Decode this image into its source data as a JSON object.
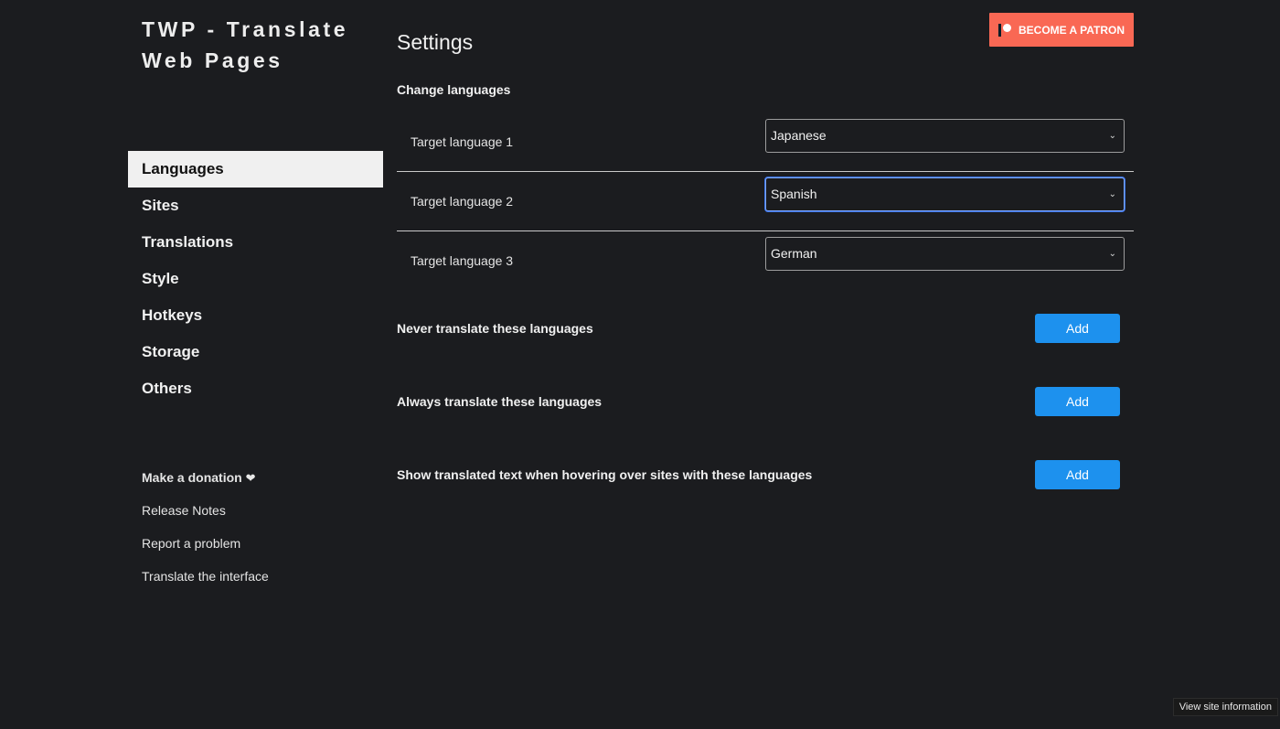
{
  "app": {
    "title": "TWP - Translate Web Pages"
  },
  "header": {
    "page_title": "Settings",
    "patron_label": "BECOME A PATRON"
  },
  "sidebar": {
    "items": [
      {
        "label": "Languages",
        "active": true
      },
      {
        "label": "Sites",
        "active": false
      },
      {
        "label": "Translations",
        "active": false
      },
      {
        "label": "Style",
        "active": false
      },
      {
        "label": "Hotkeys",
        "active": false
      },
      {
        "label": "Storage",
        "active": false
      },
      {
        "label": "Others",
        "active": false
      }
    ],
    "links": {
      "donation": "Make a donation",
      "donation_heart": "❤",
      "release_notes": "Release Notes",
      "report_problem": "Report a problem",
      "translate_interface": "Translate the interface"
    }
  },
  "languages": {
    "heading": "Change languages",
    "targets": [
      {
        "label": "Target language 1",
        "value": "Japanese"
      },
      {
        "label": "Target language 2",
        "value": "Spanish"
      },
      {
        "label": "Target language 3",
        "value": "German"
      }
    ],
    "options": [
      {
        "label": "Never translate these languages",
        "button": "Add"
      },
      {
        "label": "Always translate these languages",
        "button": "Add"
      },
      {
        "label": "Show translated text when hovering over sites with these languages",
        "button": "Add"
      }
    ]
  },
  "browser": {
    "site_info_tooltip": "View site information"
  },
  "colors": {
    "background": "#1b1c1f",
    "patron_accent": "#f96854",
    "button_blue": "#1d91ee",
    "active_nav_bg": "#f0f0f0",
    "focus_ring": "#3a72e8"
  },
  "icons": {
    "patron": "patreon-logo-icon",
    "select_chevron": "chevron-down-icon",
    "heart": "heart-icon"
  }
}
